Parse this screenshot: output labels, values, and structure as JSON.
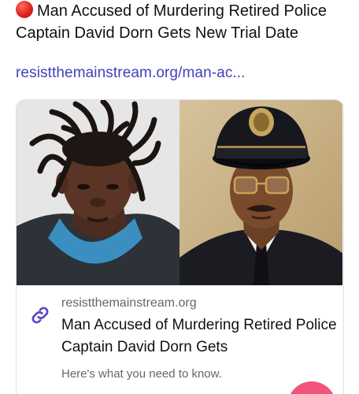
{
  "post": {
    "headline": "Man Accused of Murdering Retired Police Captain David Dorn Gets New Trial Date",
    "headline_emoji": "red-circle",
    "link": "resistthemainstream.org/man-ac..."
  },
  "card": {
    "images": [
      {
        "name": "suspect-mugshot"
      },
      {
        "name": "police-captain-portrait"
      }
    ],
    "domain": "resistthemainstream.org",
    "title": "Man Accused of Murdering Retired Police Captain David Dorn Gets",
    "description": "Here's what you need to know.",
    "icon": "link-icon"
  },
  "colors": {
    "link": "#3f3fbf",
    "accent_red": "#e0241a",
    "fab": "#f0547a"
  }
}
